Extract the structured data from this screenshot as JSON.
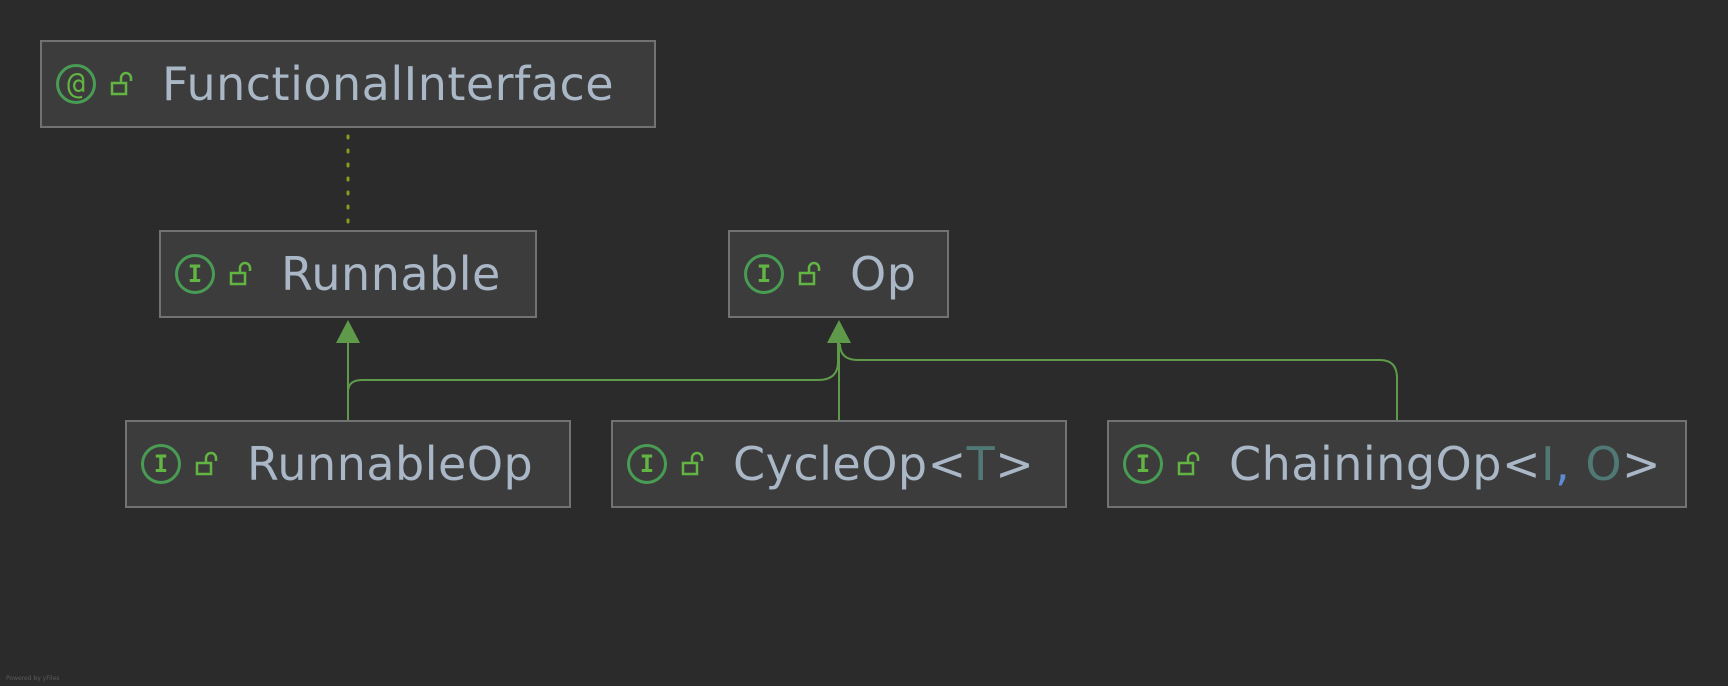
{
  "nodes": {
    "functional_interface": {
      "label": "FunctionalInterface",
      "kind_icon": "annotation-icon",
      "kind_glyph": "@",
      "visibility_icon": "unlocked-icon"
    },
    "runnable": {
      "label": "Runnable",
      "kind_icon": "interface-icon",
      "kind_glyph": "I",
      "visibility_icon": "unlocked-icon"
    },
    "op": {
      "label": "Op",
      "kind_icon": "interface-icon",
      "kind_glyph": "I",
      "visibility_icon": "unlocked-icon"
    },
    "runnable_op": {
      "label": "RunnableOp",
      "kind_icon": "interface-icon",
      "kind_glyph": "I",
      "visibility_icon": "unlocked-icon"
    },
    "cycle_op": {
      "name": "CycleOp",
      "lt": "<",
      "param": "T",
      "gt": ">",
      "kind_icon": "interface-icon",
      "kind_glyph": "I",
      "visibility_icon": "unlocked-icon"
    },
    "chaining_op": {
      "name": "ChainingOp",
      "lt": "<",
      "param1": "I",
      "comma": ",",
      "param2": "O",
      "gt": ">",
      "kind_icon": "interface-icon",
      "kind_glyph": "I",
      "visibility_icon": "unlocked-icon"
    }
  },
  "edges": [
    {
      "from": "runnable",
      "to": "functional_interface",
      "style": "dotted"
    },
    {
      "from": "runnable_op",
      "to": "runnable",
      "style": "extends"
    },
    {
      "from": "runnable_op",
      "to": "op",
      "style": "extends"
    },
    {
      "from": "cycle_op",
      "to": "op",
      "style": "extends"
    },
    {
      "from": "chaining_op",
      "to": "op",
      "style": "extends"
    }
  ],
  "colors": {
    "background": "#2b2b2b",
    "node_fill": "#3c3c3c",
    "node_border": "#727272",
    "edge": "#5e9a4a",
    "dotted_edge": "#8a9a1e",
    "label": "#a9b7c6"
  },
  "footer": "Powered by yFiles"
}
